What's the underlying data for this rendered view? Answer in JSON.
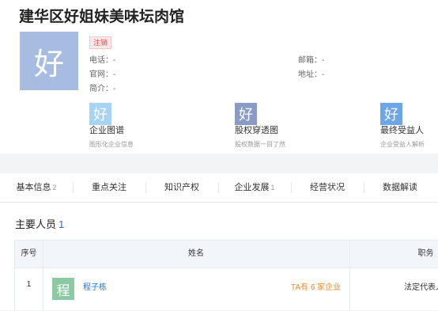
{
  "company": {
    "name": "建华区好姐妹美味坛肉馆",
    "logo_char": "好",
    "status_tag": "注销"
  },
  "info": {
    "phone_label": "电话：",
    "phone_value": "-",
    "website_label": "官网：",
    "website_value": "-",
    "intro_label": "简介：",
    "intro_value": "-",
    "email_label": "邮箱：",
    "email_value": "-",
    "address_label": "地址：",
    "address_value": "-"
  },
  "cards": [
    {
      "icon_char": "好",
      "title": "企业图谱",
      "subtitle": "图形化企业信息",
      "color": "#a7d4f5"
    },
    {
      "icon_char": "好",
      "title": "股权穿透图",
      "subtitle": "股权数据一目了然",
      "color": "#8a9bc7"
    },
    {
      "icon_char": "好",
      "title": "最终受益人",
      "subtitle": "企业受益人解析",
      "color": "#6aa6e8"
    }
  ],
  "tabs": [
    {
      "label": "基本信息",
      "count": "2"
    },
    {
      "label": "重点关注",
      "count": ""
    },
    {
      "label": "知识产权",
      "count": ""
    },
    {
      "label": "企业发展",
      "count": "1"
    },
    {
      "label": "经营状况",
      "count": ""
    },
    {
      "label": "数据解读",
      "count": ""
    }
  ],
  "section": {
    "title": "主要人员",
    "count": "1",
    "columns": {
      "index": "序号",
      "name": "姓名",
      "position": "职务"
    },
    "rows": [
      {
        "index": "1",
        "avatar_char": "程",
        "name": "程子栋",
        "companies": "TA有 6 家企业",
        "position": "法定代表人"
      }
    ]
  },
  "colors": {
    "accent_blue": "#1a73e8",
    "tag_red": "#e64545",
    "orange": "#f08a24"
  }
}
